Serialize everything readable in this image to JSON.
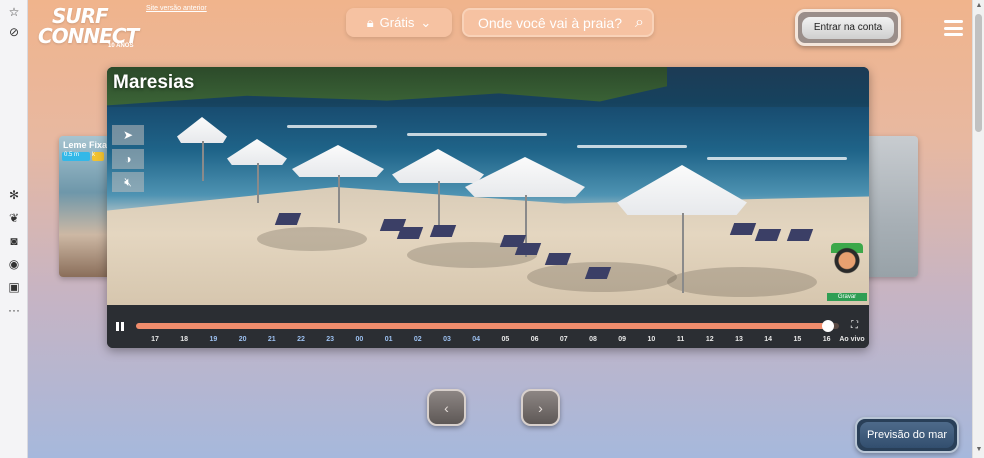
{
  "header": {
    "logo_line1": "SURF",
    "logo_line2": "CONNECT",
    "logo_sub": "10 ANOS",
    "old_version_link": "Site versão anterior",
    "plan_label": "Grátis",
    "search_placeholder": "Onde você vai à praia?",
    "login_label": "Entrar na conta"
  },
  "cams": {
    "main_title": "Maresias",
    "left_title": "Leme Fixa",
    "left_badge_wave": "0.5 m",
    "left_badge_extra": "k",
    "record_label": "Gravar"
  },
  "timeline": {
    "progress_fraction": 0.985,
    "hours": [
      "17",
      "18",
      "19",
      "20",
      "21",
      "22",
      "23",
      "00",
      "01",
      "02",
      "03",
      "04",
      "05",
      "06",
      "07",
      "08",
      "09",
      "10",
      "11",
      "12",
      "13",
      "14",
      "15",
      "16"
    ],
    "past_hours": [
      "19",
      "20",
      "21",
      "22",
      "23",
      "00",
      "01",
      "02",
      "03",
      "04"
    ],
    "live_label": "Ao vivo"
  },
  "nav": {
    "prev": "‹",
    "next": "›"
  },
  "forecast_label": "Previsão do mar",
  "colors": {
    "accent": "#f08c6c",
    "record": "#2f9e54",
    "wave_badge": "#33b8e8"
  }
}
